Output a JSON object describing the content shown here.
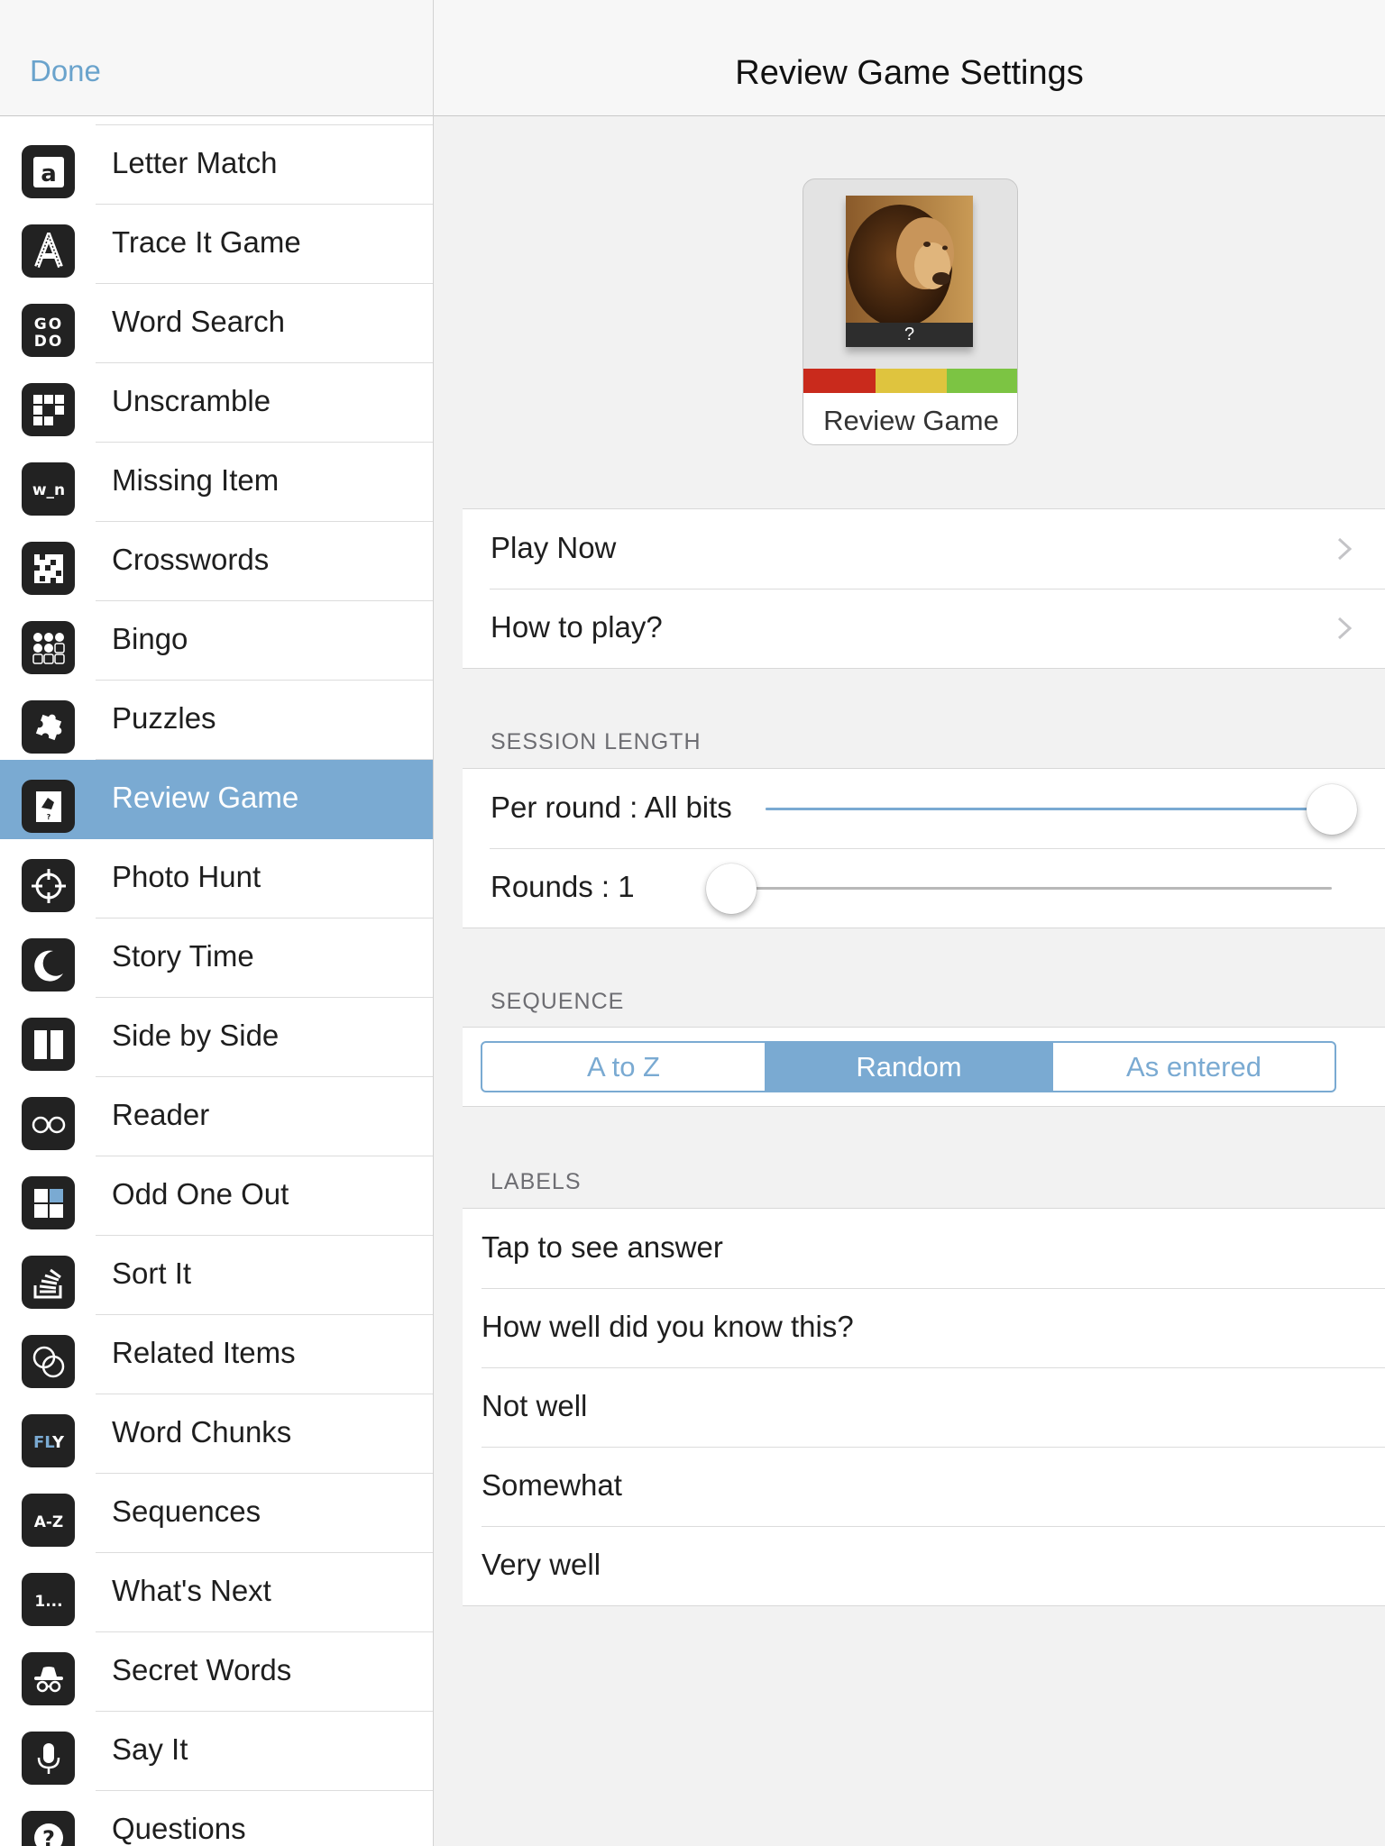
{
  "sidebar": {
    "done_label": "Done",
    "items": [
      {
        "label": "Letter Match",
        "icon": "letter-a-icon",
        "glyph": "a"
      },
      {
        "label": "Trace It Game",
        "icon": "letter-trace-icon",
        "glyph": "A"
      },
      {
        "label": "Word Search",
        "icon": "word-search-icon",
        "glyph": "GO DO"
      },
      {
        "label": "Unscramble",
        "icon": "grid-blocks-icon",
        "glyph": ""
      },
      {
        "label": "Missing Item",
        "icon": "missing-letter-icon",
        "glyph": "w_n"
      },
      {
        "label": "Crosswords",
        "icon": "crossword-grid-icon",
        "glyph": ""
      },
      {
        "label": "Bingo",
        "icon": "bingo-dots-icon",
        "glyph": ""
      },
      {
        "label": "Puzzles",
        "icon": "puzzle-piece-icon",
        "glyph": ""
      },
      {
        "label": "Review Game",
        "icon": "review-card-icon",
        "glyph": "",
        "selected": true
      },
      {
        "label": "Photo Hunt",
        "icon": "crosshair-icon",
        "glyph": ""
      },
      {
        "label": "Story Time",
        "icon": "moon-icon",
        "glyph": ""
      },
      {
        "label": "Side by Side",
        "icon": "side-by-side-icon",
        "glyph": ""
      },
      {
        "label": "Reader",
        "icon": "glasses-icon",
        "glyph": ""
      },
      {
        "label": "Odd One Out",
        "icon": "four-squares-icon",
        "glyph": ""
      },
      {
        "label": "Sort It",
        "icon": "stack-icon",
        "glyph": ""
      },
      {
        "label": "Related Items",
        "icon": "linked-circles-icon",
        "glyph": ""
      },
      {
        "label": "Word Chunks",
        "icon": "word-chunks-icon",
        "glyph": "FLY"
      },
      {
        "label": "Sequences",
        "icon": "a-to-z-icon",
        "glyph": "A-Z"
      },
      {
        "label": "What's Next",
        "icon": "ellipsis-number-icon",
        "glyph": "1..."
      },
      {
        "label": "Secret Words",
        "icon": "spy-hat-icon",
        "glyph": ""
      },
      {
        "label": "Say It",
        "icon": "microphone-icon",
        "glyph": ""
      },
      {
        "label": "Questions",
        "icon": "question-mark-icon",
        "glyph": "?"
      }
    ]
  },
  "header": {
    "title": "Review Game Settings"
  },
  "card": {
    "question_mark": "?",
    "label": "Review Game",
    "bar_colors": [
      "#c92a1c",
      "#dfc43e",
      "#7cc443"
    ]
  },
  "actions": [
    {
      "label": "Play Now"
    },
    {
      "label": "How to play?"
    }
  ],
  "session_length": {
    "title": "SESSION LENGTH",
    "per_round_label": "Per round : All bits",
    "per_round_level": 1.0,
    "rounds_label": "Rounds : 1",
    "rounds_level": 0.0
  },
  "sequence": {
    "title": "SEQUENCE",
    "options": [
      "A to Z",
      "Random",
      "As entered"
    ],
    "selected": "Random"
  },
  "labels": {
    "title": "LABELS",
    "items": [
      "Tap to see answer",
      "How well did you know this?",
      "Not well",
      "Somewhat",
      "Very well"
    ]
  },
  "colors": {
    "accent": "#7aaad2",
    "link": "#6aa3cc"
  }
}
